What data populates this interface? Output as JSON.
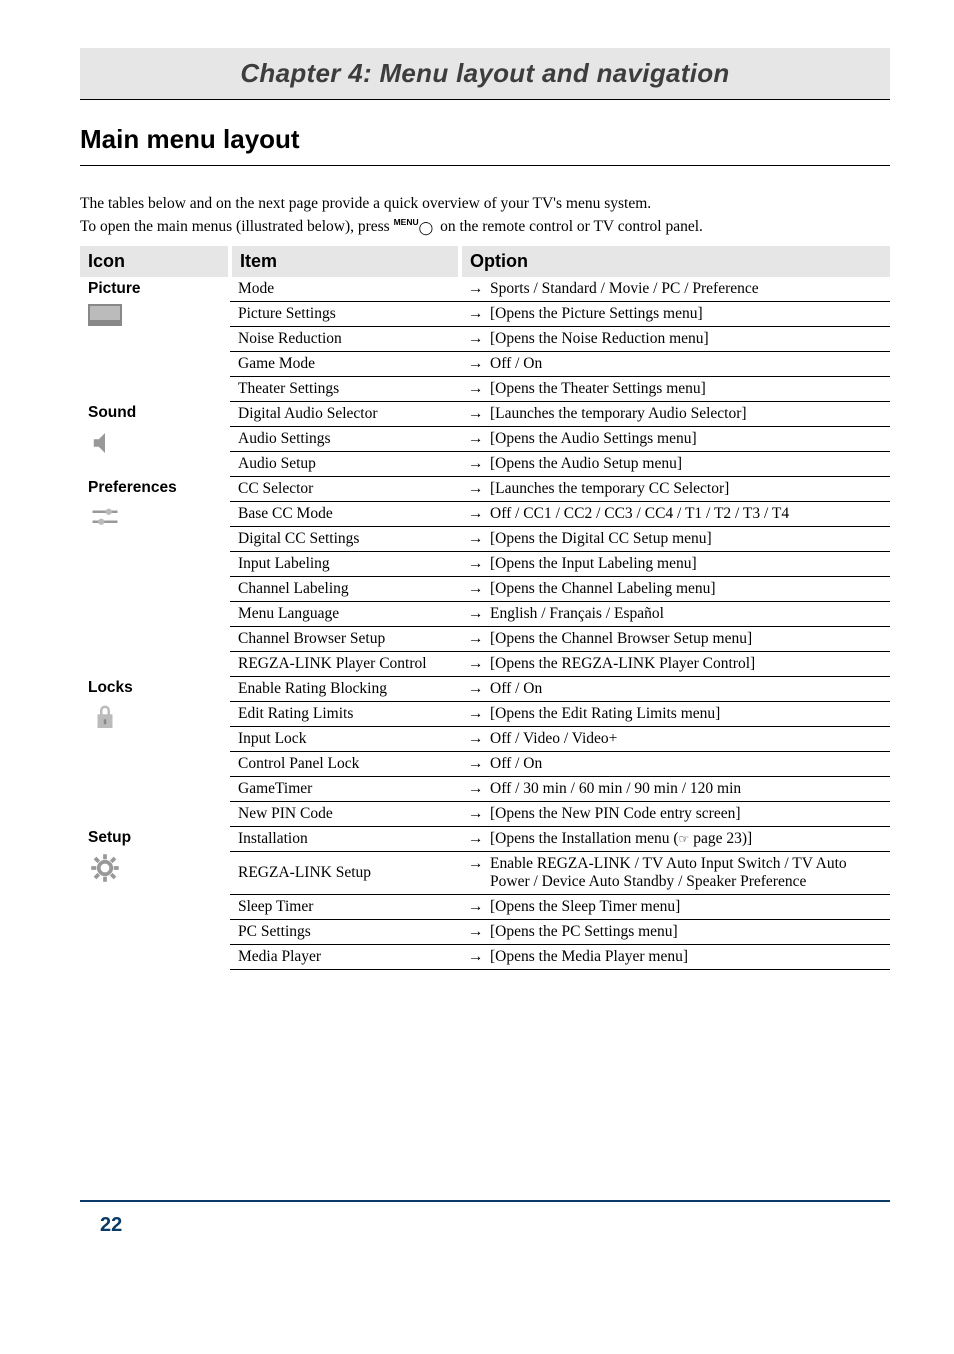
{
  "chapter_title": "Chapter 4: Menu layout and navigation",
  "section_title": "Main menu layout",
  "intro_line1": "The tables below and on the next page provide a quick overview of your TV's menu system.",
  "intro_line2a": "To open the main menus (illustrated below), press ",
  "intro_menu_label": "MENU",
  "intro_line2b": " on the remote control or TV control panel.",
  "headers": {
    "icon": "Icon",
    "item": "Item",
    "option": "Option"
  },
  "arrow": "→",
  "pointer": "☞",
  "sections": {
    "picture": {
      "label": "Picture",
      "rows": [
        {
          "item": "Mode",
          "option": "Sports / Standard / Movie / PC / Preference"
        },
        {
          "item": "Picture Settings",
          "option": "[Opens the Picture Settings menu]"
        },
        {
          "item": "Noise Reduction",
          "option": "[Opens the Noise Reduction menu]"
        },
        {
          "item": "Game Mode",
          "option": "Off / On"
        },
        {
          "item": "Theater Settings",
          "option": "[Opens the Theater Settings menu]"
        }
      ]
    },
    "sound": {
      "label": "Sound",
      "rows": [
        {
          "item": "Digital Audio Selector",
          "option": "[Launches the temporary Audio Selector]"
        },
        {
          "item": "Audio Settings",
          "option": "[Opens the Audio Settings menu]"
        },
        {
          "item": "Audio Setup",
          "option": "[Opens the Audio Setup menu]"
        }
      ]
    },
    "preferences": {
      "label": "Preferences",
      "rows": [
        {
          "item": "CC Selector",
          "option": "[Launches the temporary CC Selector]"
        },
        {
          "item": "Base CC Mode",
          "option": "Off / CC1 / CC2 / CC3 / CC4 / T1 / T2 / T3 / T4"
        },
        {
          "item": "Digital CC Settings",
          "option": "[Opens the Digital CC Setup menu]"
        },
        {
          "item": "Input Labeling",
          "option": "[Opens the Input Labeling menu]"
        },
        {
          "item": "Channel Labeling",
          "option": "[Opens the Channel Labeling menu]"
        },
        {
          "item": "Menu Language",
          "option": "English / Français / Español"
        },
        {
          "item": "Channel Browser Setup",
          "option": "[Opens the Channel Browser Setup menu]"
        },
        {
          "item": "REGZA-LINK Player Control",
          "option": "[Opens the REGZA-LINK Player Control]"
        }
      ]
    },
    "locks": {
      "label": "Locks",
      "rows": [
        {
          "item": "Enable Rating Blocking",
          "option": "Off / On"
        },
        {
          "item": "Edit Rating Limits",
          "option": "[Opens the Edit Rating Limits menu]"
        },
        {
          "item": "Input Lock",
          "option": "Off / Video / Video+"
        },
        {
          "item": "Control Panel Lock",
          "option": "Off / On"
        },
        {
          "item": "GameTimer",
          "option": "Off / 30 min / 60 min / 90 min / 120 min"
        },
        {
          "item": "New PIN Code",
          "option": "[Opens the New PIN Code entry screen]"
        }
      ]
    },
    "setup": {
      "label": "Setup",
      "rows": [
        {
          "item": "Installation",
          "option_pre": "[Opens the Installation menu (",
          "option_post": " page 23)]"
        },
        {
          "item": "REGZA-LINK Setup",
          "option": "Enable REGZA-LINK / TV Auto Input Switch / TV Auto Power / Device Auto Standby / Speaker Preference"
        },
        {
          "item": "Sleep Timer",
          "option": "[Opens the Sleep Timer menu]"
        },
        {
          "item": "PC Settings",
          "option": "[Opens the PC Settings menu]"
        },
        {
          "item": "Media Player",
          "option": "[Opens the Media Player menu]"
        }
      ]
    }
  },
  "page_number": "22"
}
